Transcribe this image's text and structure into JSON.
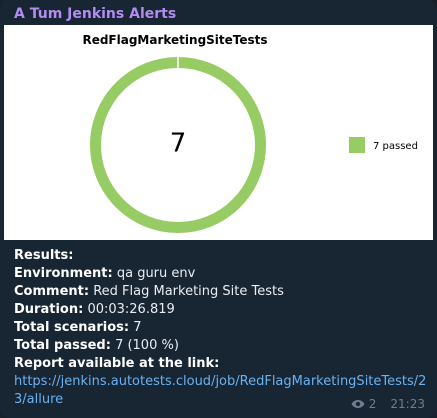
{
  "channel": {
    "title": "A Tum Jenkins Alerts",
    "accent": "#b38cf2"
  },
  "chart_data": {
    "type": "pie",
    "title": "RedFlagMarketingSiteTests",
    "center_label": "7",
    "slices": [
      {
        "label": "7 passed",
        "value": 7,
        "color": "#97cc64"
      }
    ]
  },
  "message": {
    "results_label": "Results:",
    "environment_label": "Environment:",
    "environment_value": "qa guru env",
    "comment_label": "Comment:",
    "comment_value": "Red Flag Marketing Site Tests",
    "duration_label": "Duration:",
    "duration_value": "00:03:26.819",
    "total_scenarios_label": "Total scenarios:",
    "total_scenarios_value": "7",
    "total_passed_label": "Total passed:",
    "total_passed_value": "7 (100 %)",
    "report_label": "Report available at the link:",
    "report_link": "https://jenkins.autotests.cloud/job/RedFlagMarketingSiteTests/23/allure"
  },
  "meta": {
    "views": "2",
    "time": "21:23",
    "views_icon": "eye-icon"
  }
}
